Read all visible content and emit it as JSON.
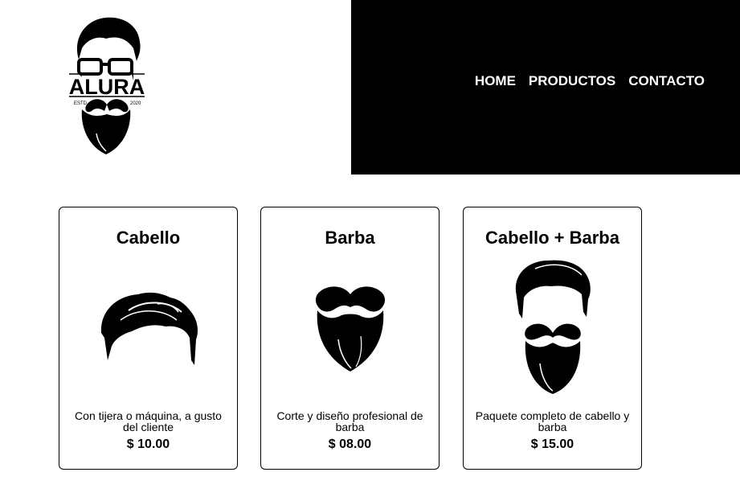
{
  "brand": {
    "logo_text": "ALURA",
    "logo_left": "ESTD",
    "logo_right": "2020"
  },
  "nav": {
    "items": [
      {
        "label": "HOME"
      },
      {
        "label": "PRODUCTOS"
      },
      {
        "label": "CONTACTO"
      }
    ]
  },
  "products": [
    {
      "title": "Cabello",
      "icon": "hair-icon",
      "description": "Con tijera o máquina, a gusto del cliente",
      "price": "$ 10.00"
    },
    {
      "title": "Barba",
      "icon": "beard-icon",
      "description": "Corte y diseño profesional de barba",
      "price": "$ 08.00"
    },
    {
      "title": "Cabello + Barba",
      "icon": "hair-beard-icon",
      "description": "Paquete completo de cabello y barba",
      "price": "$ 15.00"
    }
  ]
}
